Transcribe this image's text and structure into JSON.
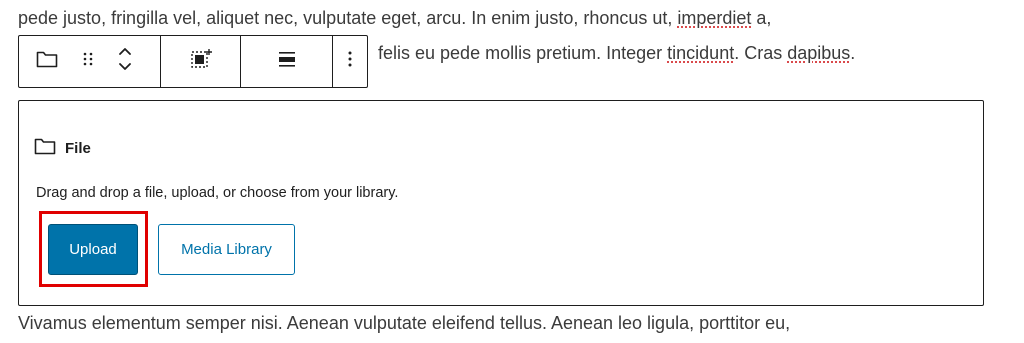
{
  "content": {
    "paragraph_top": {
      "line1_a": "pede justo, fringilla vel, aliquet nec, vulputate eget, arcu. In enim justo, rhoncus ut, ",
      "line1_spell": "imperdiet",
      "line1_b": " a,",
      "line2_a": "felis eu pede mollis pretium. Integer ",
      "line2_spell1": "tincidunt",
      "line2_b": ". Cras ",
      "line2_spell2": "dapibus",
      "line2_c": "."
    },
    "paragraph_bottom": "Vivamus elementum semper nisi. Aenean vulputate eleifend tellus. Aenean leo ligula, porttitor eu,"
  },
  "toolbar": {
    "icons": {
      "block_type": "folder-icon",
      "drag": "drag-handle-icon",
      "move": "move-up-down-icon",
      "replace": "replace-icon",
      "align": "align-icon",
      "more": "more-options-icon"
    }
  },
  "file_block": {
    "icon": "folder-icon",
    "title": "File",
    "instructions": "Drag and drop a file, upload, or choose from your library.",
    "upload_label": "Upload",
    "media_library_label": "Media Library"
  },
  "colors": {
    "primary": "#0073aa",
    "highlight": "#e00000",
    "border": "#1e1e1e",
    "text": "#3b3b3b"
  }
}
